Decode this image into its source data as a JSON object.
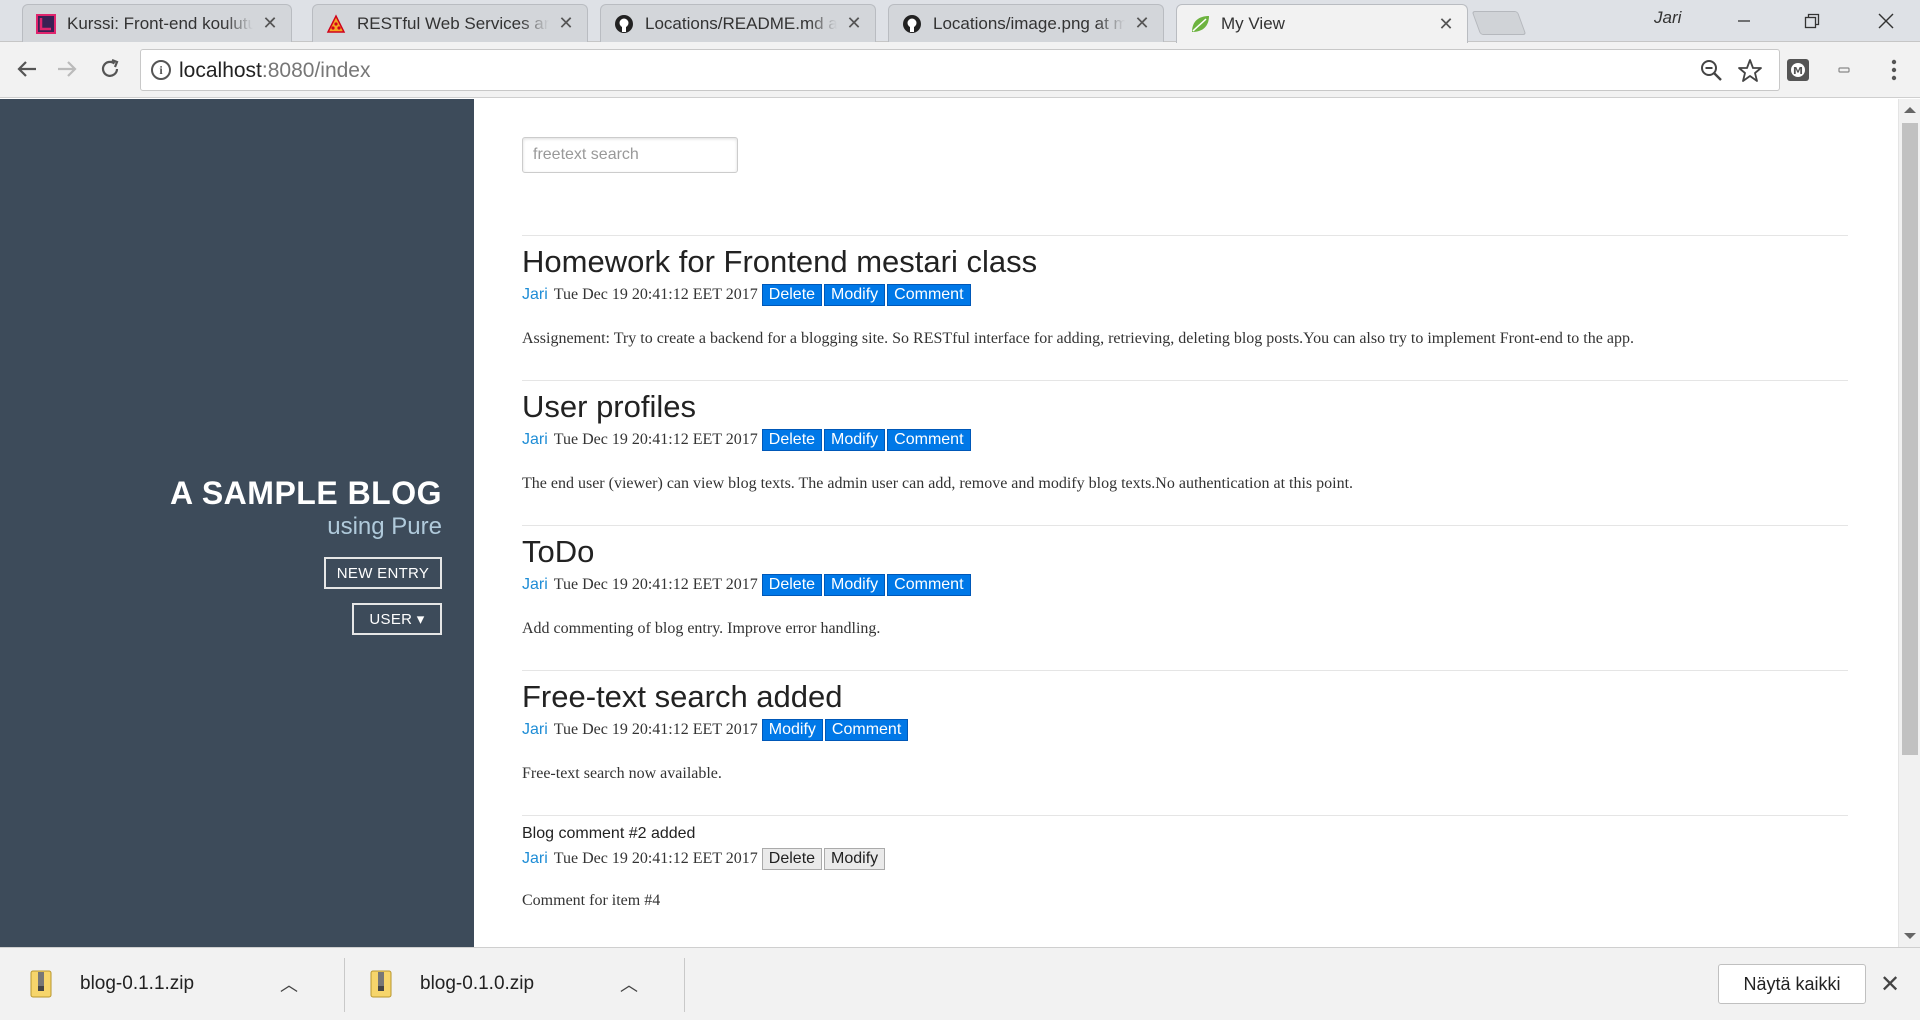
{
  "browser": {
    "tabs": [
      {
        "title": "Kurssi: Front-end koulutus",
        "icon": "course-icon",
        "active": false
      },
      {
        "title": "RESTful Web Services and",
        "icon": "pizza-icon",
        "active": false
      },
      {
        "title": "Locations/README.md at",
        "icon": "github-icon",
        "active": false
      },
      {
        "title": "Locations/image.png at m",
        "icon": "github-icon",
        "active": false
      },
      {
        "title": "My View",
        "icon": "spring-leaf-icon",
        "active": true
      }
    ],
    "close_glyph": "✕",
    "user_name": "Jari",
    "url_host": "localhost",
    "url_path": ":8080/index",
    "info_glyph": "i"
  },
  "sidebar": {
    "title": "A SAMPLE BLOG",
    "tagline": "using Pure",
    "new_entry_label": "NEW ENTRY",
    "user_label": "USER ▾"
  },
  "search": {
    "placeholder": "freetext search"
  },
  "posts": [
    {
      "title": "Homework for Frontend mestari class",
      "author": "Jari",
      "date": "Tue Dec 19 20:41:12 EET 2017",
      "buttons": [
        "Delete",
        "Modify",
        "Comment"
      ],
      "body": "Assignement: Try to create a backend for a blogging site. So RESTful interface for adding, retrieving, deleting blog posts.You can also try to implement Front-end to the app."
    },
    {
      "title": "User profiles",
      "author": "Jari",
      "date": "Tue Dec 19 20:41:12 EET 2017",
      "buttons": [
        "Delete",
        "Modify",
        "Comment"
      ],
      "body": "The end user (viewer) can view blog texts. The admin user can add, remove and modify blog texts.No authentication at this point."
    },
    {
      "title": "ToDo",
      "author": "Jari",
      "date": "Tue Dec 19 20:41:12 EET 2017",
      "buttons": [
        "Delete",
        "Modify",
        "Comment"
      ],
      "body": "Add commenting of blog entry. Improve error handling."
    },
    {
      "title": "Free-text search added",
      "author": "Jari",
      "date": "Tue Dec 19 20:41:12 EET 2017",
      "buttons": [
        "Modify",
        "Comment"
      ],
      "body": "Free-text search now available."
    }
  ],
  "comment": {
    "title": "Blog comment #2 added",
    "author": "Jari",
    "date": "Tue Dec 19 20:41:12 EET 2017",
    "buttons": [
      "Delete",
      "Modify"
    ],
    "body": "Comment for item #4"
  },
  "downloads": {
    "items": [
      {
        "name": "blog-0.1.1.zip"
      },
      {
        "name": "blog-0.1.0.zip"
      }
    ],
    "caret_glyph": "︿",
    "show_all_label": "Näytä kaikki",
    "close_glyph": "✕"
  },
  "colors": {
    "sidebar_bg": "#3d4b5a",
    "button_primary": "#0078e7",
    "author_link": "#1f8dd6"
  }
}
